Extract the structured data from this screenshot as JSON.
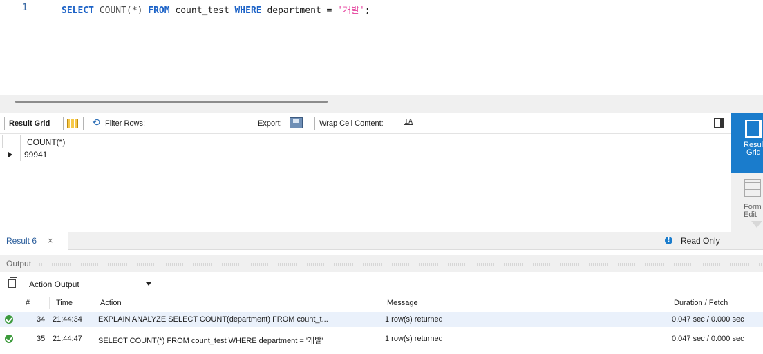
{
  "editor": {
    "line_number": "1",
    "sql": {
      "kw_select": "SELECT",
      "fn_count": " COUNT(*) ",
      "kw_from": "FROM",
      "table": " count_test ",
      "kw_where": "WHERE",
      "condition": " department = ",
      "string": "'개발'",
      "terminator": ";"
    }
  },
  "result_toolbar": {
    "result_grid_label": "Result Grid",
    "filter_rows_label": "Filter Rows:",
    "filter_value": "",
    "export_label": "Export:",
    "wrap_label": "Wrap Cell Content:",
    "wrap_icon": "IA"
  },
  "grid": {
    "columns": [
      "COUNT(*)"
    ],
    "rows": [
      [
        "99941"
      ]
    ]
  },
  "side_panel": {
    "active_label_1": "Resul",
    "active_label_2": "Grid",
    "form_label_1": "Form",
    "form_label_2": "Edit"
  },
  "result_tab": {
    "label": "Result 6",
    "close": "×",
    "read_only_icon": "!",
    "read_only": "Read Only"
  },
  "output": {
    "title": "Output",
    "selected_view": "Action Output",
    "headers": {
      "num": "#",
      "time": "Time",
      "action": "Action",
      "message": "Message",
      "duration": "Duration / Fetch"
    },
    "rows": [
      {
        "num": "34",
        "time": "21:44:34",
        "action": "EXPLAIN ANALYZE SELECT COUNT(department) FROM count_t...",
        "message": "1 row(s) returned",
        "duration": "0.047 sec / 0.000 sec"
      },
      {
        "num": "35",
        "time": "21:44:47",
        "action": "SELECT COUNT(*) FROM count_test WHERE department = '개발'",
        "message": "1 row(s) returned",
        "duration": "0.047 sec / 0.000 sec"
      }
    ]
  },
  "colors": {
    "accent": "#1a7ccc",
    "keyword": "#1d63c7",
    "string": "#e53e9b",
    "success": "#3c9a3c",
    "row_alt": "#eaf1fb"
  }
}
